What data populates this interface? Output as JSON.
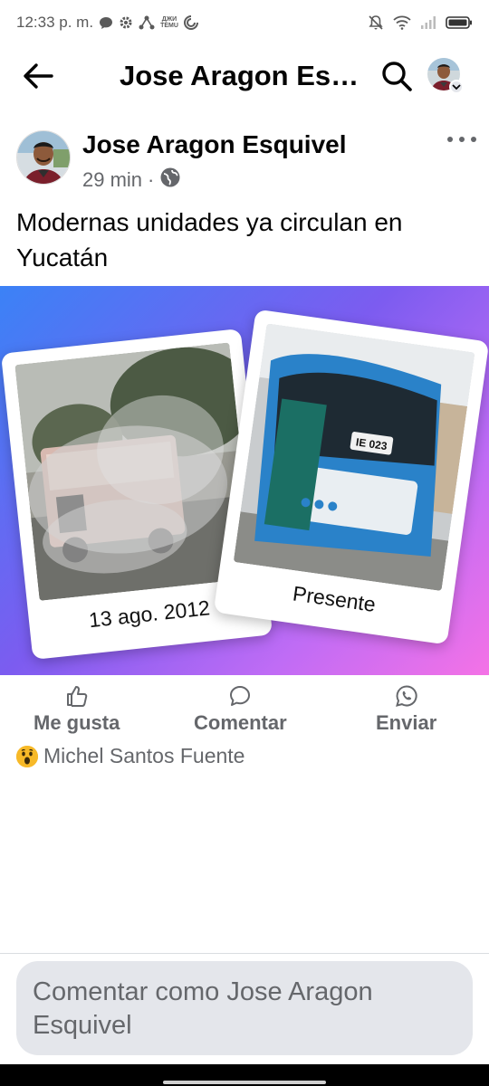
{
  "status_bar": {
    "time": "12:33 p. m.",
    "temu_top": "ДЖИ",
    "temu_label": "TEMU"
  },
  "app_bar": {
    "title": "Jose Aragon Esq…"
  },
  "post": {
    "author": "Jose Aragon Esquivel",
    "time": "29 min",
    "separator": "·",
    "text": "Modernas unidades ya circulan en Yucatán",
    "image": {
      "left_caption": "13 ago. 2012",
      "right_caption": "Presente",
      "bus_plate": "IE 023"
    }
  },
  "actions": {
    "like": "Me gusta",
    "comment": "Comentar",
    "send": "Enviar"
  },
  "reactions": {
    "names": "Michel Santos Fuente",
    "emoji": "wow-emoji"
  },
  "comment_input": {
    "placeholder": "Comentar como Jose Aragon Esquivel"
  },
  "colors": {
    "secondary_text": "#65676b",
    "primary_text": "#050505",
    "input_bg": "#e4e6eb",
    "gradient_start": "#3b82f6",
    "gradient_end": "#f472e6"
  }
}
